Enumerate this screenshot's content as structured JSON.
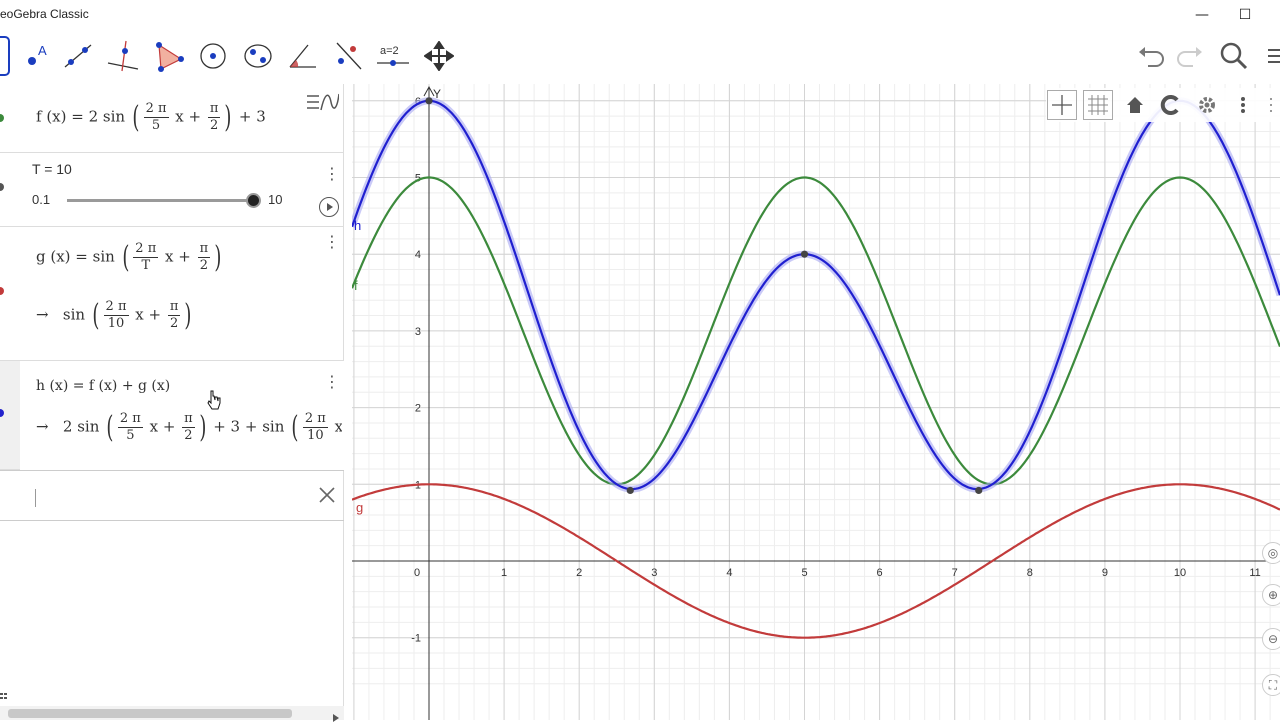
{
  "window": {
    "title": "eoGebra Classic",
    "minimize_label": "—",
    "maximize_label": "☐"
  },
  "toolbar": {
    "tools": [
      {
        "name": "move-tool-icon"
      },
      {
        "name": "point-tool-icon"
      },
      {
        "name": "line-tool-icon"
      },
      {
        "name": "perpendicular-tool-icon"
      },
      {
        "name": "polygon-tool-icon"
      },
      {
        "name": "circle-tool-icon"
      },
      {
        "name": "ellipse-tool-icon"
      },
      {
        "name": "angle-tool-icon"
      },
      {
        "name": "reflect-tool-icon"
      },
      {
        "name": "slider-tool-icon",
        "label": "a=2"
      },
      {
        "name": "move-graphics-tool-icon"
      }
    ],
    "right": [
      "undo-icon",
      "redo-icon",
      "search-icon",
      "menu-icon"
    ]
  },
  "algebra": {
    "rows": [
      {
        "id": "f",
        "color": "#3c8a3c",
        "lhs": "f (x)  =  2  sin",
        "frac1_num": "2 π",
        "frac1_den": "5",
        "mid": "x +",
        "frac2_num": "π",
        "frac2_den": "2",
        "tail": "+ 3"
      },
      {
        "id": "T",
        "label": "T = 10",
        "min": "0.1",
        "max": "10",
        "value": 10,
        "value_fraction": 1.0
      },
      {
        "id": "g",
        "color": "#c23b3b",
        "lhs": "g (x) = sin",
        "frac1_num": "2 π",
        "frac1_den": "T",
        "mid": "x +",
        "frac2_num": "π",
        "frac2_den": "2",
        "arrow": "→",
        "res_lhs": "sin",
        "res_frac1_num": "2 π",
        "res_frac1_den": "10",
        "res_mid": "x +",
        "res_frac2_num": "π",
        "res_frac2_den": "2"
      },
      {
        "id": "h",
        "color": "#2222cc",
        "lhs": "h (x) = f (x) + g (x)",
        "arrow": "→",
        "res_lhs": "2  sin",
        "res_frac1_num": "2 π",
        "res_frac1_den": "5",
        "res_mid": "x +",
        "res_frac2_num": "π",
        "res_frac2_den": "2",
        "res_tail": "+ 3 + sin",
        "res_frac3_num": "2 π",
        "res_frac3_den": "10",
        "res_tail2": "x -"
      }
    ],
    "input_placeholder": ""
  },
  "chart_data": {
    "type": "line",
    "xlim": [
      -1,
      11.5
    ],
    "ylim": [
      -1.6,
      6.2
    ],
    "grid": true,
    "x_ticks": [
      "0",
      "1",
      "2",
      "3",
      "4",
      "5",
      "6",
      "7",
      "8",
      "9",
      "10",
      "11"
    ],
    "y_ticks": [
      "-1",
      "1",
      "2",
      "3",
      "4",
      "5",
      "6"
    ],
    "ylabel": "Y",
    "series": [
      {
        "name": "f",
        "expression": "2 sin(2π/5 x + π/2) + 3",
        "color": "#3c8a3c"
      },
      {
        "name": "g",
        "expression": "sin(2π/10 x + π/2)",
        "color": "#c23b3b"
      },
      {
        "name": "h",
        "expression": "f(x) + g(x)",
        "color": "#2020d0"
      }
    ],
    "points": [
      {
        "x": 0,
        "y": 6
      },
      {
        "x": 2.68,
        "y": 0.92
      },
      {
        "x": 5,
        "y": 4
      },
      {
        "x": 7.32,
        "y": 0.92
      }
    ]
  }
}
